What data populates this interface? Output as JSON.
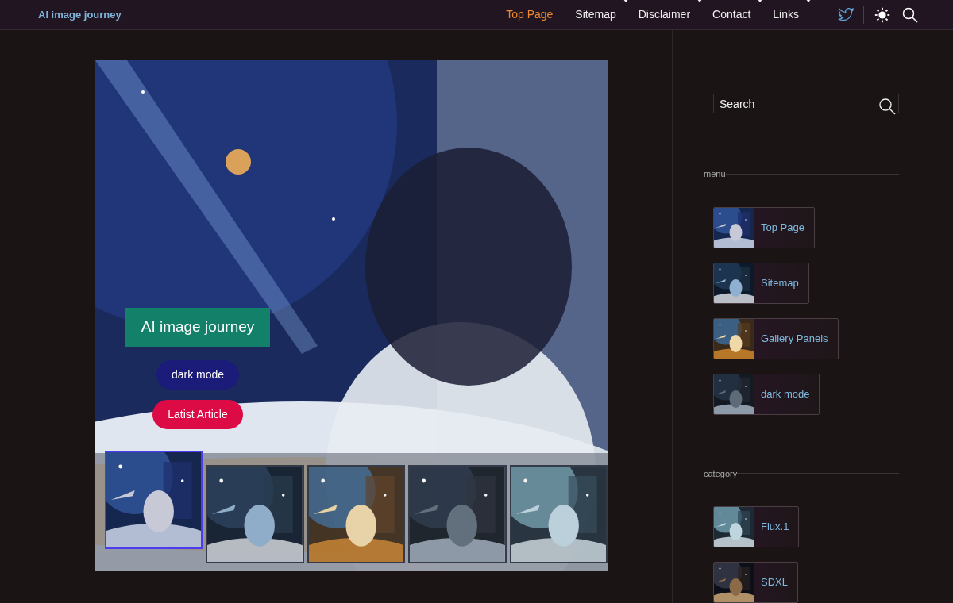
{
  "header": {
    "site_title": "AI image journey",
    "nav": [
      {
        "label": "Top Page",
        "selected": true,
        "has_dropdown": false
      },
      {
        "label": "Sitemap",
        "selected": false,
        "has_dropdown": true
      },
      {
        "label": "Disclaimer",
        "selected": false,
        "has_dropdown": true
      },
      {
        "label": "Contact",
        "selected": false,
        "has_dropdown": true
      },
      {
        "label": "Links",
        "selected": false,
        "has_dropdown": true
      }
    ]
  },
  "hero": {
    "title": "AI image journey",
    "buttons": [
      {
        "label": "dark mode",
        "color": "#1b1b7a"
      },
      {
        "label": "Latist Article",
        "color": "#dc0a45"
      }
    ],
    "thumbnails": [
      {
        "selected": true
      },
      {
        "selected": false
      },
      {
        "selected": false
      },
      {
        "selected": false
      },
      {
        "selected": false
      }
    ]
  },
  "sidebar": {
    "search": {
      "placeholder": "Search"
    },
    "sections": [
      {
        "heading": "menu",
        "items": [
          {
            "label": "Top Page"
          },
          {
            "label": "Sitemap"
          },
          {
            "label": "Gallery Panels"
          },
          {
            "label": "dark mode"
          }
        ]
      },
      {
        "heading": "category",
        "items": [
          {
            "label": "Flux.1"
          },
          {
            "label": "SDXL"
          }
        ]
      }
    ]
  }
}
